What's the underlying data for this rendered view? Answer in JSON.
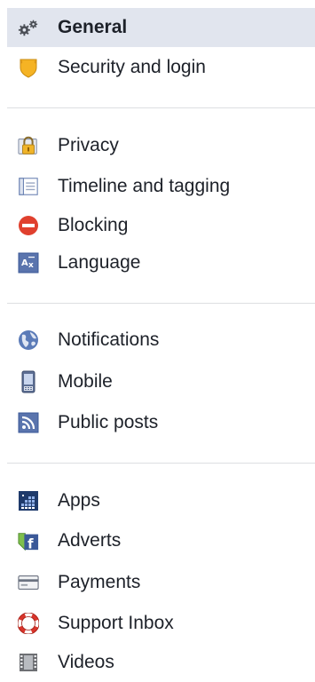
{
  "sections": [
    [
      {
        "id": "general",
        "label": "General",
        "icon": "gears-icon",
        "selected": true
      },
      {
        "id": "security",
        "label": "Security and login",
        "icon": "shield-icon",
        "selected": false
      }
    ],
    [
      {
        "id": "privacy",
        "label": "Privacy",
        "icon": "padlock-icon",
        "selected": false
      },
      {
        "id": "timeline",
        "label": "Timeline and tagging",
        "icon": "timeline-icon",
        "selected": false
      },
      {
        "id": "blocking",
        "label": "Blocking",
        "icon": "blocking-icon",
        "selected": false
      },
      {
        "id": "language",
        "label": "Language",
        "icon": "language-icon",
        "selected": false
      }
    ],
    [
      {
        "id": "notifications",
        "label": "Notifications",
        "icon": "globe-icon",
        "selected": false
      },
      {
        "id": "mobile",
        "label": "Mobile",
        "icon": "phone-icon",
        "selected": false
      },
      {
        "id": "public-posts",
        "label": "Public posts",
        "icon": "rss-icon",
        "selected": false
      }
    ],
    [
      {
        "id": "apps",
        "label": "Apps",
        "icon": "apps-icon",
        "selected": false
      },
      {
        "id": "adverts",
        "label": "Adverts",
        "icon": "adverts-icon",
        "selected": false
      },
      {
        "id": "payments",
        "label": "Payments",
        "icon": "credit-card-icon",
        "selected": false
      },
      {
        "id": "support-inbox",
        "label": "Support Inbox",
        "icon": "lifebuoy-icon",
        "selected": false
      },
      {
        "id": "videos",
        "label": "Videos",
        "icon": "film-icon",
        "selected": false
      }
    ]
  ],
  "colors": {
    "selected_bg": "#e1e5ee",
    "divider": "#dddfe2",
    "text": "#1d2129",
    "icon_blue": "#3b5998"
  }
}
